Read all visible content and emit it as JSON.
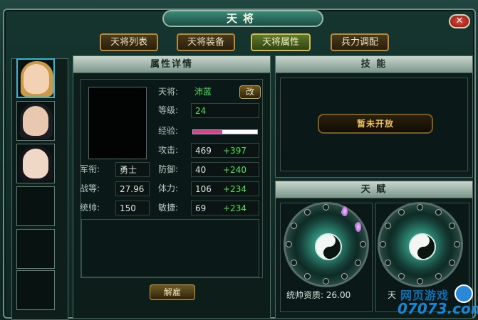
{
  "window": {
    "title": "天将",
    "close_label": "✕"
  },
  "tabs": [
    {
      "label": "天将列表",
      "active": false
    },
    {
      "label": "天将装备",
      "active": false
    },
    {
      "label": "天将属性",
      "active": true
    },
    {
      "label": "兵力调配",
      "active": false
    }
  ],
  "portraits": [
    {
      "name": "portrait-1",
      "selected": true
    },
    {
      "name": "portrait-2",
      "selected": false
    },
    {
      "name": "portrait-3",
      "selected": false
    },
    {
      "name": "empty-slot",
      "selected": false
    },
    {
      "name": "empty-slot",
      "selected": false
    },
    {
      "name": "empty-slot",
      "selected": false
    }
  ],
  "attributes": {
    "header": "属性详情",
    "general_label": "天将:",
    "general_name": "沛蓝",
    "rename_button": "改",
    "level_label": "等级:",
    "level_value": "24",
    "exp_label": "经验:",
    "exp_progress": 0.45,
    "attack_label": "攻击:",
    "attack_value": "469",
    "attack_bonus": "+397",
    "defense_label": "防御:",
    "defense_value": "40",
    "defense_bonus": "+240",
    "stamina_label": "体力:",
    "stamina_value": "106",
    "stamina_bonus": "+234",
    "agility_label": "敏捷:",
    "agility_value": "69",
    "agility_bonus": "+234",
    "rank_label": "军衔:",
    "rank_value": "勇士",
    "battle_label": "战等:",
    "battle_value": "27.96",
    "command_label": "统帅:",
    "command_value": "150",
    "dismiss_button": "解雇"
  },
  "skills": {
    "header": "技 能",
    "status": "暂未开放"
  },
  "talent": {
    "header": "天 赋",
    "command_aptitude_label": "统帅资质: 26.00",
    "second_label": "天"
  },
  "watermark": {
    "line1": "网页游戏",
    "line2": "07073.com"
  },
  "colors": {
    "accent_green": "#4ee35a",
    "selected_border": "#2fb7d6",
    "xp_fill": "#d8448a"
  }
}
